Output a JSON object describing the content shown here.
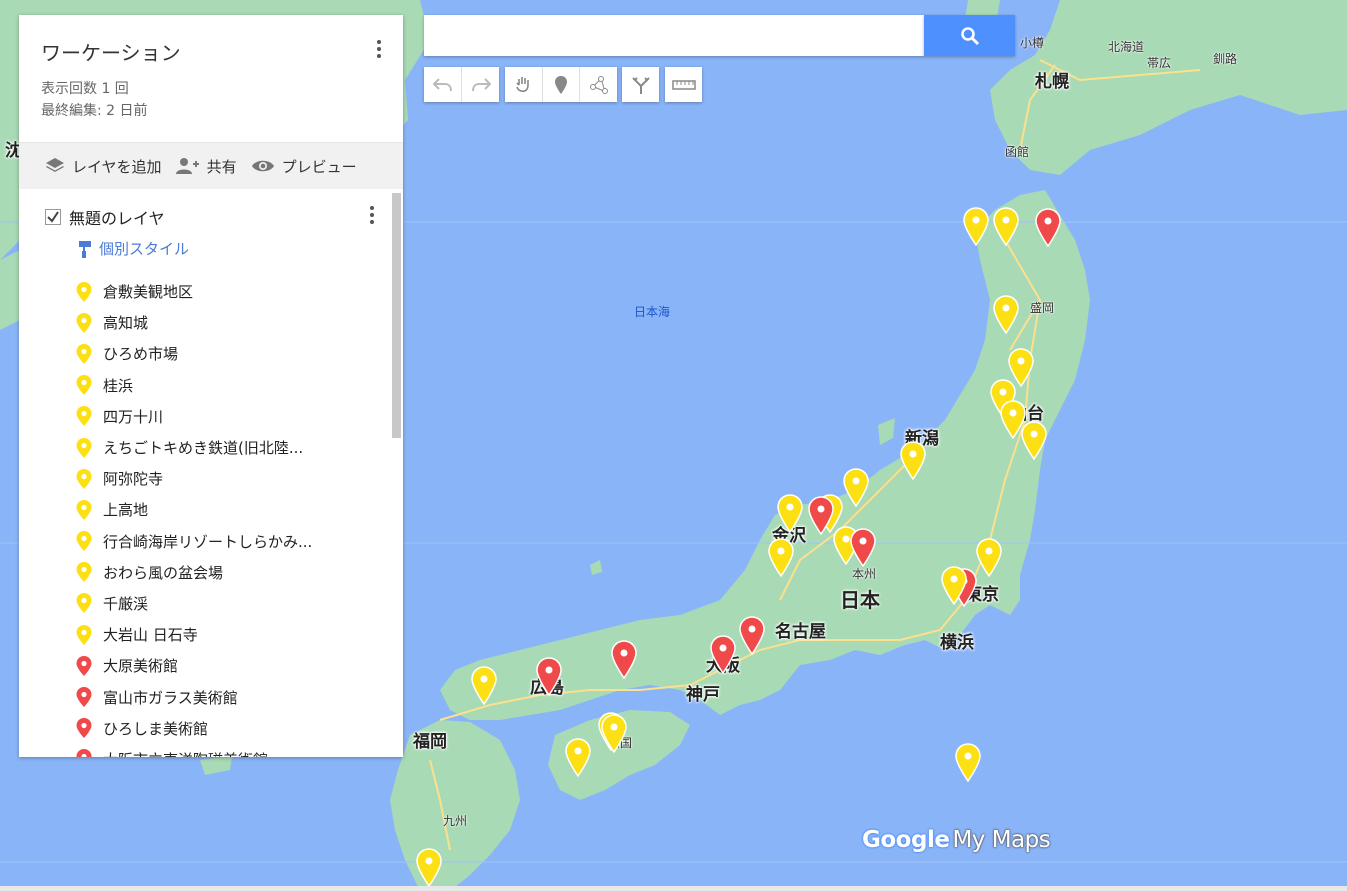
{
  "colors": {
    "pin_yellow": "#fde013",
    "pin_red": "#f0494a",
    "land": "#a8dab5",
    "water": "#8ab4f8",
    "accent": "#4d90fe"
  },
  "panel": {
    "title": "ワーケーション",
    "views": "表示回数 1 回",
    "last_edit": "最終編集: 2 日前",
    "actions": {
      "add_layer": "レイヤを追加",
      "share": "共有",
      "preview": "プレビュー"
    },
    "layer": {
      "name": "無題のレイヤ",
      "style": "個別スタイル",
      "items": [
        {
          "label": "倉敷美観地区",
          "color": "yellow"
        },
        {
          "label": "高知城",
          "color": "yellow"
        },
        {
          "label": "ひろめ市場",
          "color": "yellow"
        },
        {
          "label": "桂浜",
          "color": "yellow"
        },
        {
          "label": "四万十川",
          "color": "yellow"
        },
        {
          "label": "えちごトキめき鉄道(旧北陸...",
          "color": "yellow"
        },
        {
          "label": "阿弥陀寺",
          "color": "yellow"
        },
        {
          "label": "上高地",
          "color": "yellow"
        },
        {
          "label": "行合崎海岸リゾートしらかみ...",
          "color": "yellow"
        },
        {
          "label": "おわら風の盆会場",
          "color": "yellow"
        },
        {
          "label": "千厳渓",
          "color": "yellow"
        },
        {
          "label": "大岩山 日石寺",
          "color": "yellow"
        },
        {
          "label": "大原美術館",
          "color": "red"
        },
        {
          "label": "富山市ガラス美術館",
          "color": "red"
        },
        {
          "label": "ひろしま美術館",
          "color": "red"
        },
        {
          "label": "大阪市立東洋陶磁美術館",
          "color": "red"
        }
      ]
    }
  },
  "search": {
    "placeholder": ""
  },
  "toolbar": [
    "undo-icon",
    "redo-icon",
    "hand-icon",
    "marker-icon",
    "line-icon",
    "directions-icon",
    "ruler-icon"
  ],
  "map": {
    "labels": {
      "otaru": "小樽",
      "sapporo": "札幌",
      "hokkaido": "北海道",
      "obihiro": "帯広",
      "kushiro": "釧路",
      "hakodate": "函館",
      "morioka": "盛岡",
      "sendai": "仙台",
      "niigata": "新潟",
      "honshu": "本州",
      "nihon": "日本",
      "tokyo": "東京",
      "yokohama": "横浜",
      "nagoya": "名古屋",
      "osaka": "大阪",
      "kobe": "神戸",
      "hiroshima": "広島",
      "fukuoka": "福岡",
      "kyushu": "九州",
      "sea_of_japan": "日本海",
      "kanazawa": "金沢",
      "shikoku": "四国",
      "partial_left": "沈"
    },
    "logo_google": "Google",
    "logo_mymaps": "My Maps"
  }
}
